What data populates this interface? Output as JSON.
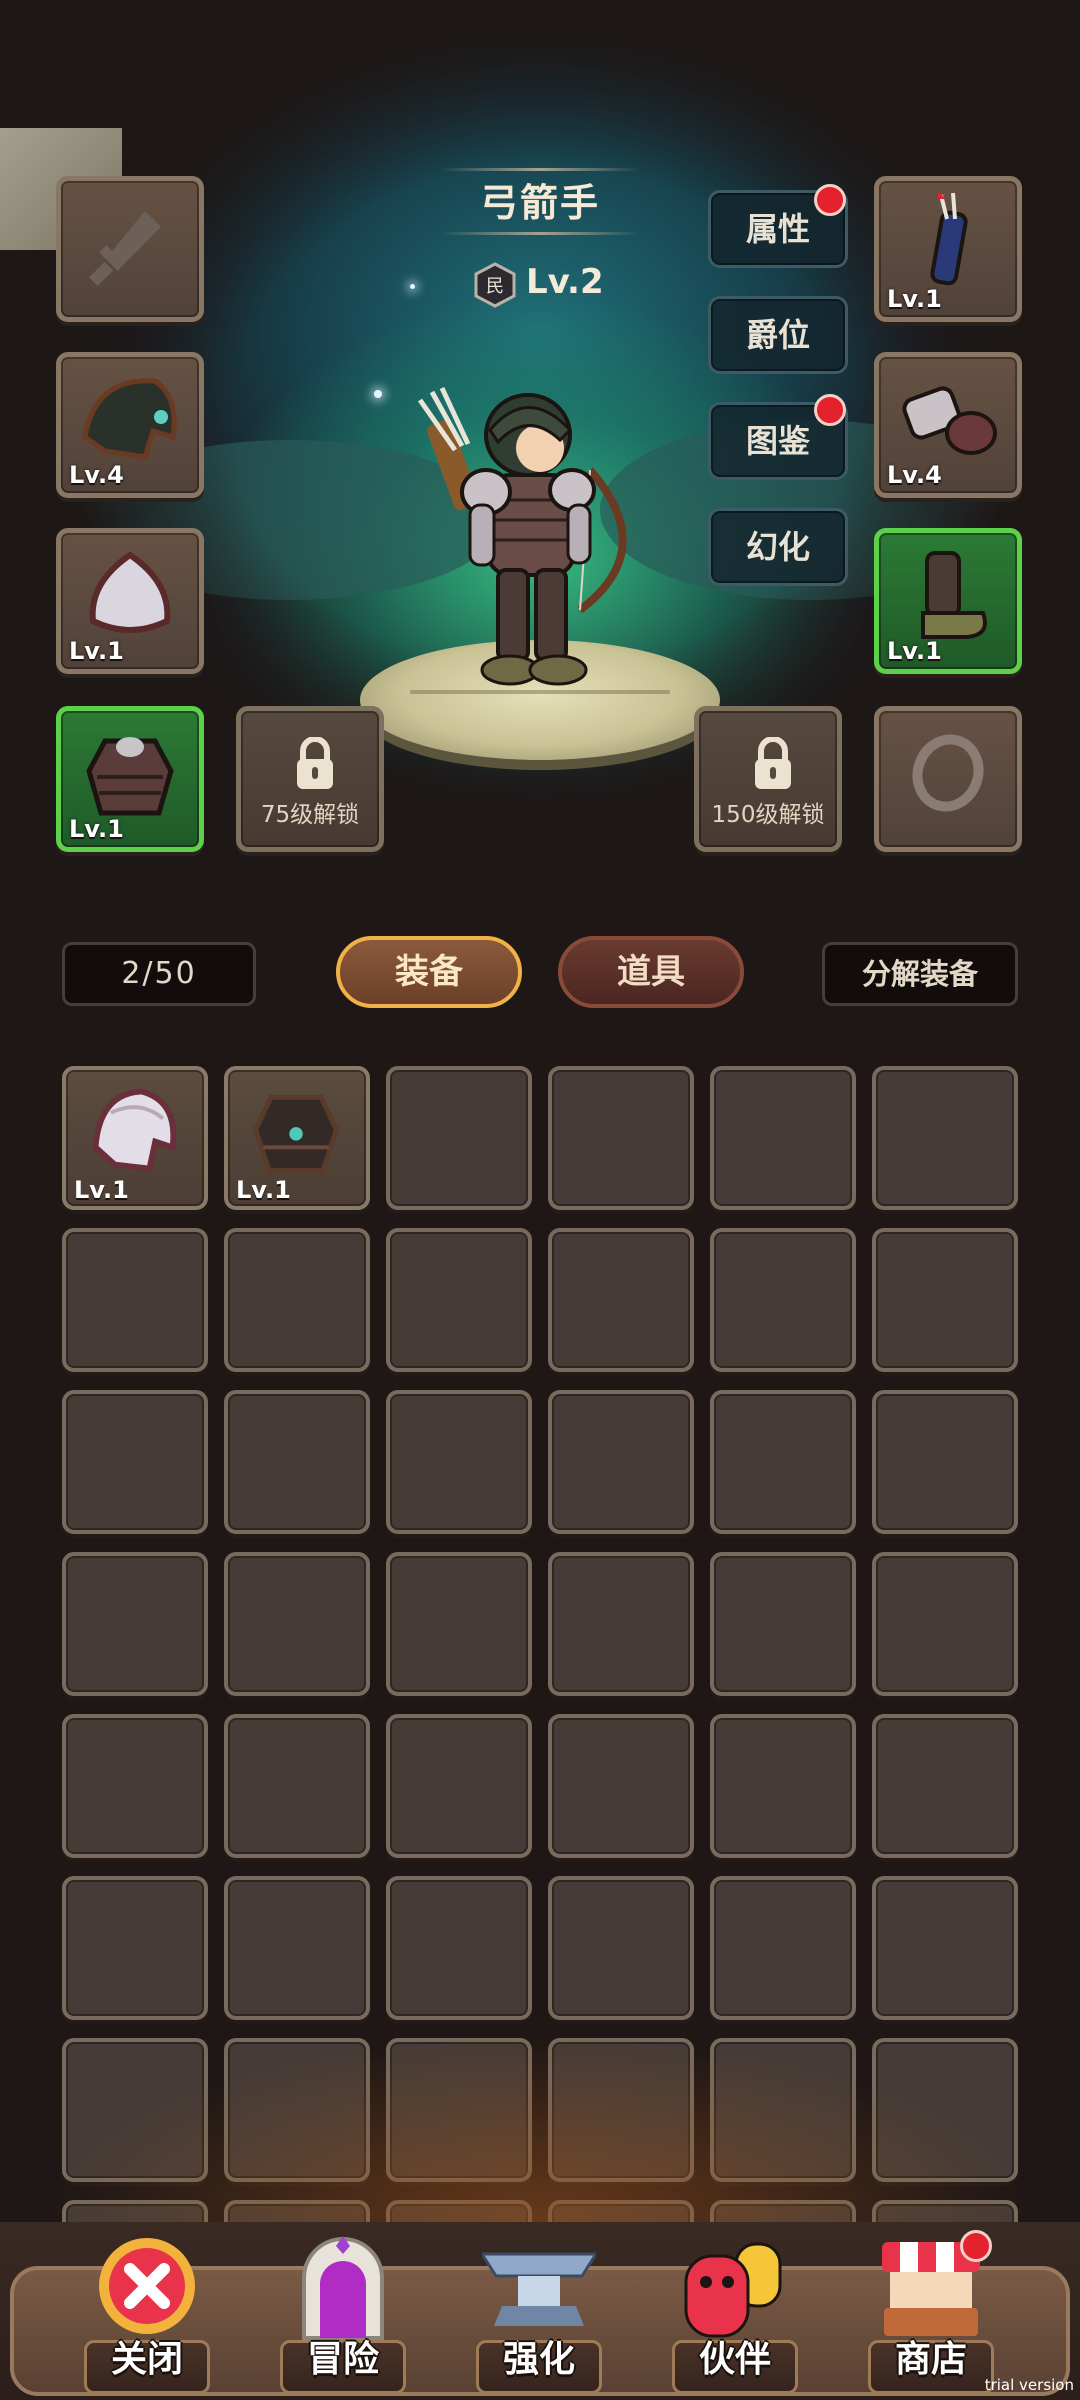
{
  "hero": {
    "class_name": "弓箭手",
    "rank_badge": "民",
    "level": "Lv.2"
  },
  "side_menu": [
    {
      "label": "属性",
      "has_notification": true
    },
    {
      "label": "爵位",
      "has_notification": false
    },
    {
      "label": "图鉴",
      "has_notification": true
    },
    {
      "label": "幻化",
      "has_notification": false
    }
  ],
  "equipment_slots": {
    "weapon": {
      "level": "",
      "icon": "sword-icon",
      "empty": true
    },
    "quiver": {
      "level": "Lv.1",
      "icon": "quiver-icon"
    },
    "helmet": {
      "level": "Lv.4",
      "icon": "helmet-icon"
    },
    "gloves": {
      "level": "Lv.4",
      "icon": "gauntlet-icon"
    },
    "shield": {
      "level": "Lv.1",
      "icon": "shield-icon"
    },
    "boots": {
      "level": "Lv.1",
      "icon": "boots-icon",
      "rarity": "green"
    },
    "armor": {
      "level": "Lv.1",
      "icon": "chest-armor-icon",
      "rarity": "green"
    },
    "ring": {
      "level": "",
      "icon": "ring-icon",
      "empty": true
    },
    "locked_a": {
      "unlock_text": "75级解锁"
    },
    "locked_b": {
      "unlock_text": "150级解锁"
    }
  },
  "inventory": {
    "count": "2/50",
    "tab_equipment": "装备",
    "tab_items": "道具",
    "active_tab": "装备",
    "decompose_label": "分解装备",
    "items": [
      {
        "level": "Lv.1",
        "icon": "helmet-icon"
      },
      {
        "level": "Lv.1",
        "icon": "chest-armor-icon"
      }
    ]
  },
  "nav": [
    {
      "label": "关闭",
      "icon": "close-icon",
      "has_notification": false
    },
    {
      "label": "冒险",
      "icon": "portal-icon",
      "has_notification": false
    },
    {
      "label": "强化",
      "icon": "anvil-icon",
      "has_notification": false
    },
    {
      "label": "伙伴",
      "icon": "companion-icon",
      "has_notification": false
    },
    {
      "label": "商店",
      "icon": "shop-icon",
      "has_notification": true
    }
  ],
  "watermark": "trial version",
  "colors": {
    "accent_orange": "#f0b246",
    "rarity_green": "#5ed14a",
    "notification_red": "#e4222e",
    "background": "#1e1715"
  }
}
